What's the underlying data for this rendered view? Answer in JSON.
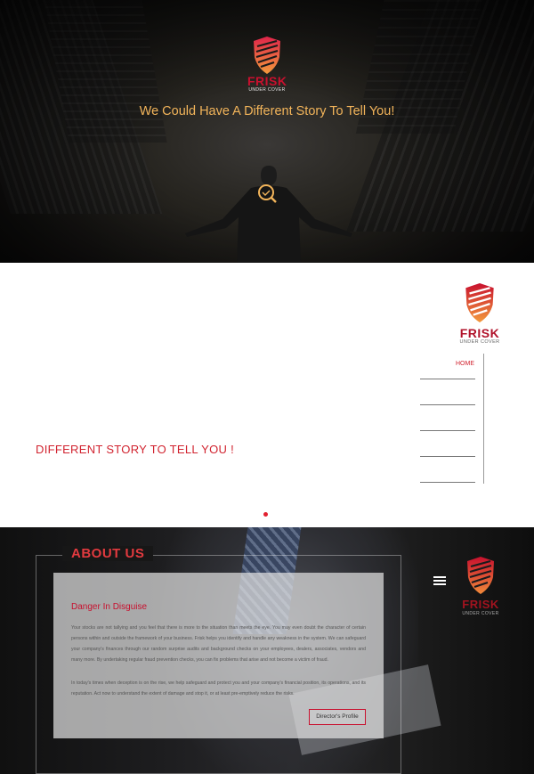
{
  "hero": {
    "logo_word": "FRISK",
    "logo_sub": "UNDER COVER",
    "tagline": "We Could Have A Different Story To Tell You!",
    "search_icon": "magnifier-icon"
  },
  "slider": {
    "logo_word": "FRISK",
    "logo_sub": "UNDER COVER",
    "headline": "DIFFERENT STORY TO TELL YOU !",
    "nav": {
      "home_label": "HOME"
    }
  },
  "about": {
    "heading": "ABOUT US",
    "card_title": "Danger In Disguise",
    "paragraph_1": "Your stocks are not tallying and you feel that there is more to the situation than meets the eye. You may even doubt the character of certain persons within and outside the framework of your business. Frisk helps you identify and handle any weakness in the system. We can safeguard your company's finances through our random surprise audits and background checks on your employees, dealers, associates, vendors and many more. By undertaking regular fraud prevention checks, you can fix problems that arise and not become a victim of fraud.",
    "paragraph_2": "In today's times when deception is on the rise, we help safeguard and protect you and your company's financial position, its operations, and its reputation. Act now to understand the extent of damage and stop it, or at least pre-emptively reduce the risks.",
    "button_label": "Director's Profile",
    "logo_word": "FRISK",
    "logo_sub": "UNDER COVER",
    "menu_icon": "hamburger-icon"
  },
  "colors": {
    "brand_red": "#c8102e",
    "accent_gold": "#f2b45a",
    "dot_red": "#e2202f"
  }
}
